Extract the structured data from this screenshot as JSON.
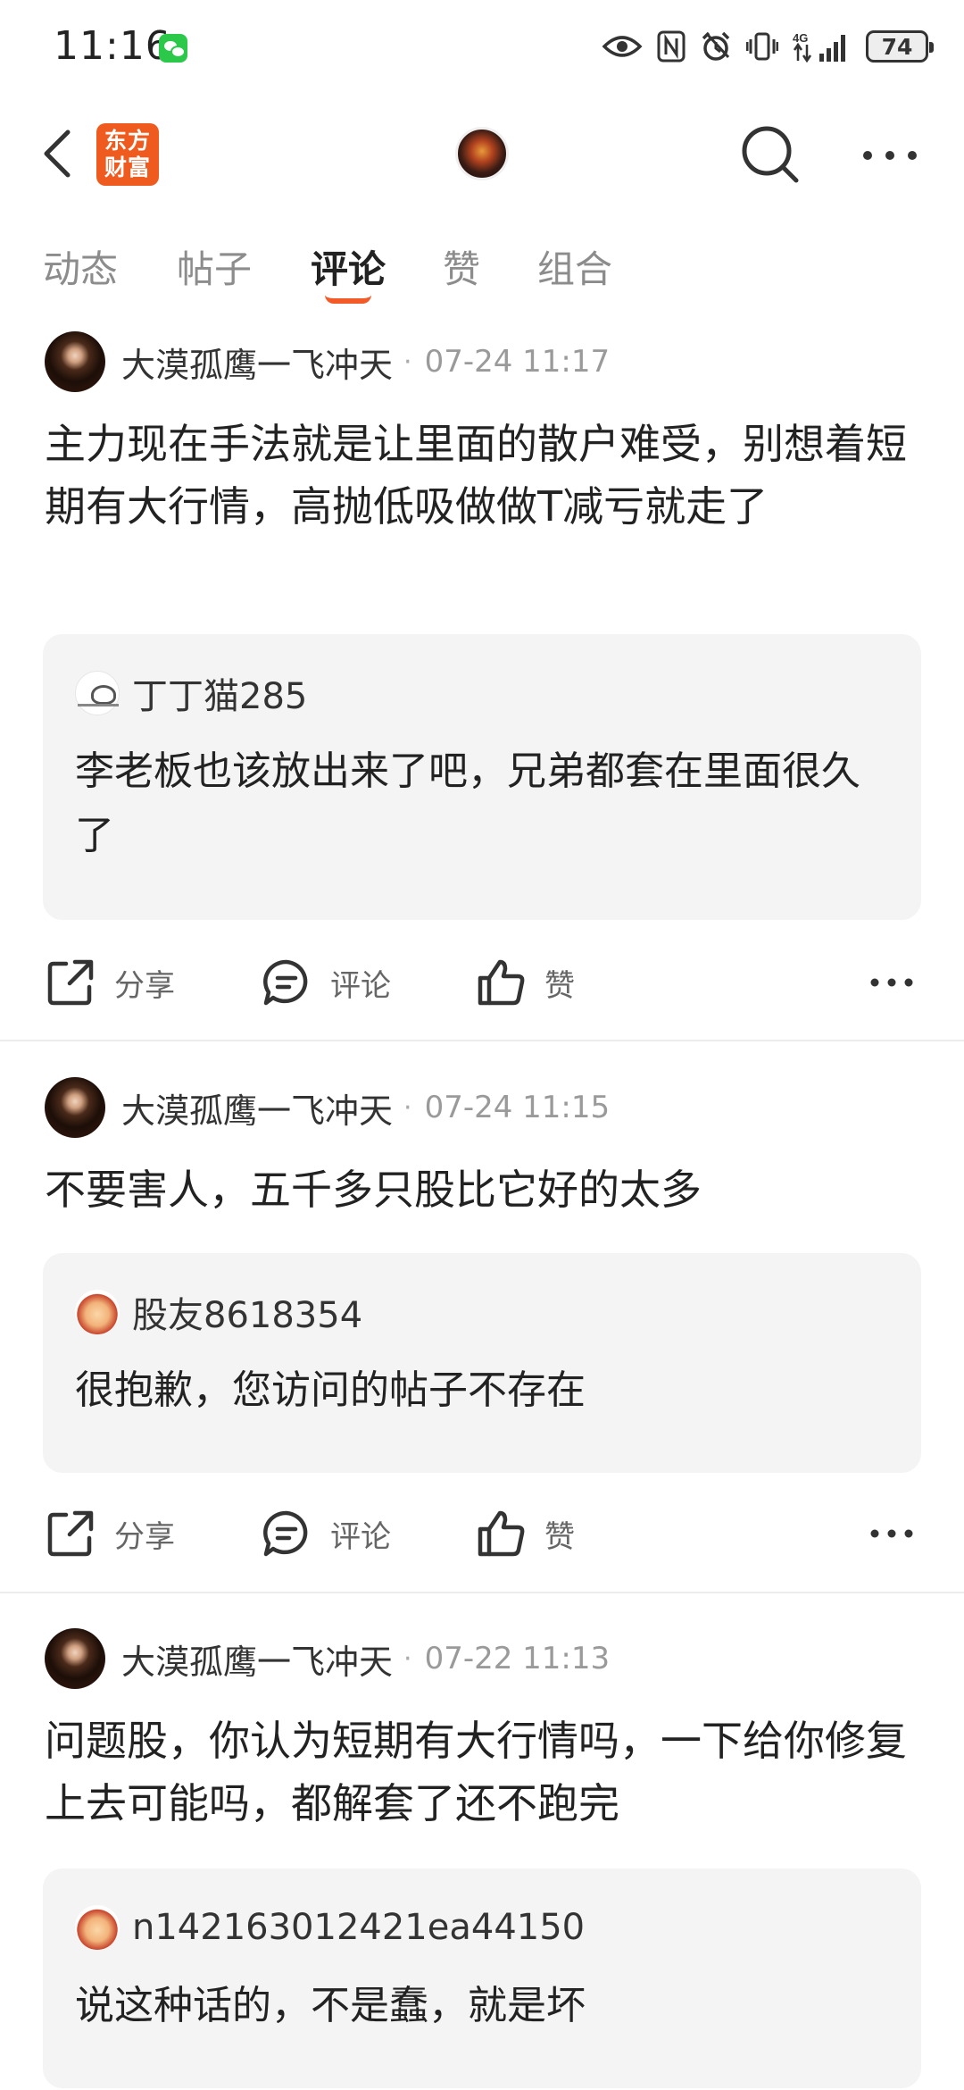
{
  "status_bar": {
    "time": "11:16",
    "network": "4G",
    "battery": "74",
    "icons": [
      "wechat-icon",
      "eye-icon",
      "nfc-icon",
      "alarm-icon",
      "vibrate-icon",
      "signal-icon",
      "battery-icon"
    ]
  },
  "header": {
    "brand_line1": "东方",
    "brand_line2": "财富",
    "brand_color": "#ef5b1e",
    "icons": [
      "back-icon",
      "search-icon",
      "more-icon"
    ]
  },
  "tabs": [
    {
      "label": "动态",
      "active": false
    },
    {
      "label": "帖子",
      "active": false
    },
    {
      "label": "评论",
      "active": true
    },
    {
      "label": "赞",
      "active": false
    },
    {
      "label": "组合",
      "active": false
    }
  ],
  "accent_color": "#f25a28",
  "actions": {
    "share": "分享",
    "comment": "评论",
    "like": "赞",
    "icons": [
      "share-icon",
      "comment-icon",
      "thumbs-up-icon",
      "more-icon"
    ]
  },
  "posts": [
    {
      "author": "大漠孤鹰一飞冲天",
      "dot": "·",
      "time": "07-24 11:17",
      "text": "主力现在手法就是让里面的散户难受，别想着短期有大行情，高抛低吸做做T减亏就走了",
      "reply": {
        "author": "丁丁猫285",
        "text": "李老板也该放出来了吧，兄弟都套在里面很久了"
      }
    },
    {
      "author": "大漠孤鹰一飞冲天",
      "dot": "·",
      "time": "07-24 11:15",
      "text": "不要害人，五千多只股比它好的太多",
      "reply": {
        "author": "股友8618354",
        "text": "很抱歉，您访问的帖子不存在"
      }
    },
    {
      "author": "大漠孤鹰一飞冲天",
      "dot": "·",
      "time": "07-22 11:13",
      "text": "问题股，你认为短期有大行情吗，一下给你修复上去可能吗，都解套了还不跑完",
      "reply": {
        "author": "n142163012421ea44150",
        "text": "说这种话的，不是蠢，就是坏"
      }
    }
  ]
}
